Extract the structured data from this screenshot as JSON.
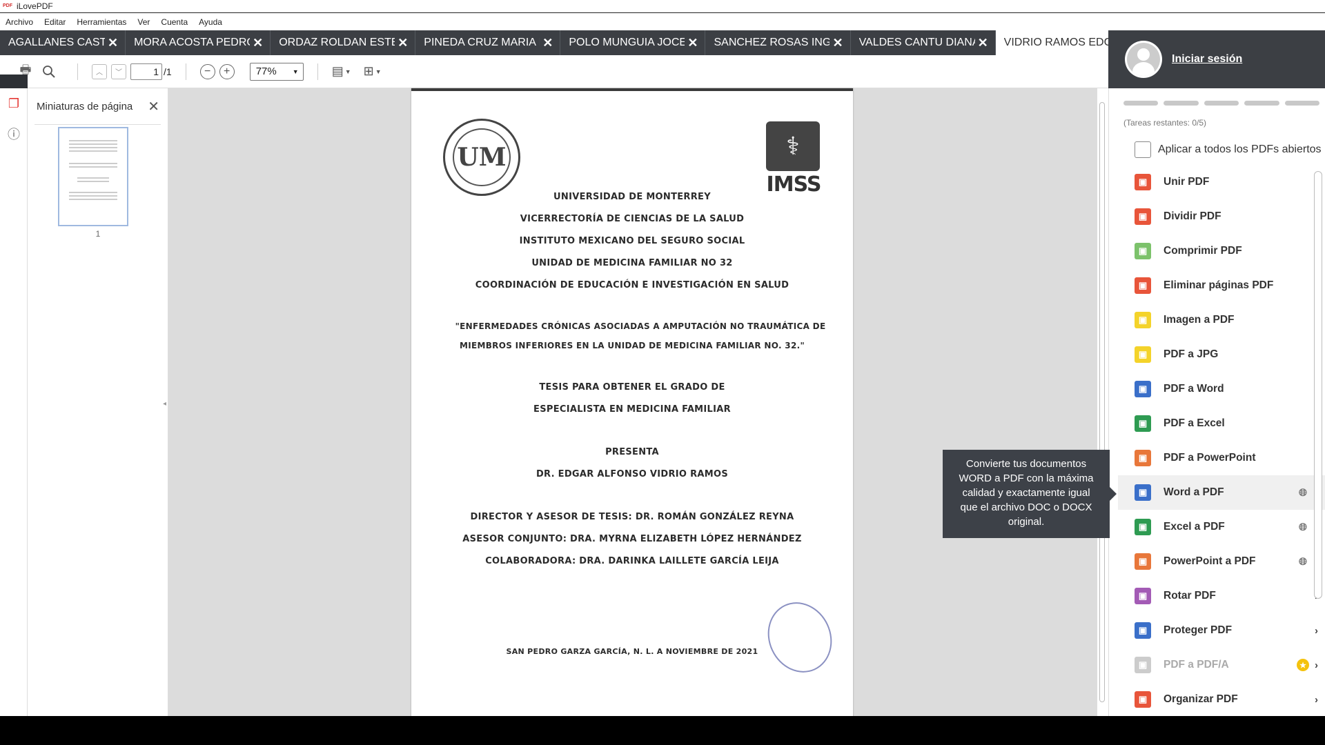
{
  "window": {
    "title": "iLovePDF",
    "app_icon": "pdf-icon"
  },
  "menu": [
    "Archivo",
    "Editar",
    "Herramientas",
    "Ver",
    "Cuenta",
    "Ayuda"
  ],
  "tabs": [
    {
      "label": "AGALLANES CASTRU"
    },
    {
      "label": "MORA ACOSTA PEDRO"
    },
    {
      "label": "ORDAZ ROLDAN ESTEF"
    },
    {
      "label": "PINEDA CRUZ MARIA I"
    },
    {
      "label": "POLO MUNGUIA JOCE"
    },
    {
      "label": "SANCHEZ ROSAS INGF"
    },
    {
      "label": "VALDES CANTU DIANA"
    },
    {
      "label": "VIDRIO RAMOS EDGAF",
      "active": true
    }
  ],
  "toolbar": {
    "page_current": "1",
    "page_total": "/1",
    "zoom": "77%"
  },
  "thumbnails": {
    "title": "Miniaturas de página",
    "page_number": "1"
  },
  "document": {
    "header_logo_right": "IMSS",
    "lines": [
      "UNIVERSIDAD DE MONTERREY",
      "VICERRECTORÍA DE CIENCIAS DE LA SALUD",
      "INSTITUTO MEXICANO DEL SEGURO SOCIAL",
      "UNIDAD DE MEDICINA FAMILIAR NO 32",
      "COORDINACIÓN DE EDUCACIÓN E INVESTIGACIÓN EN SALUD"
    ],
    "title_line1": "\"ENFERMEDADES CRÓNICAS ASOCIADAS A AMPUTACIÓN NO TRAUMÁTICA DE",
    "title_line2": "MIEMBROS INFERIORES EN LA UNIDAD DE MEDICINA FAMILIAR NO. 32.\"",
    "thesis_line1": "TESIS PARA OBTENER EL GRADO DE",
    "thesis_line2": "ESPECIALISTA EN MEDICINA FAMILIAR",
    "presenta": "PRESENTA",
    "author": "DR. EDGAR ALFONSO VIDRIO RAMOS",
    "director": "DIRECTOR Y ASESOR DE TESIS:  DR. ROMÁN GONZÁLEZ REYNA",
    "asesor": "ASESOR CONJUNTO: DRA. MYRNA ELIZABETH LÓPEZ HERNÁNDEZ",
    "colaboradora": "COLABORADORA: DRA. DARINKA LAILLETE GARCÍA LEIJA",
    "place_date": "SAN PEDRO GARZA GARCÍA, N. L. A NOVIEMBRE DE 2021"
  },
  "right_panel": {
    "login": "Iniciar sesión",
    "tasks_left": "(Tareas restantes: 0/5)",
    "apply_all": "Aplicar a todos los PDFs abiertos",
    "tools": [
      {
        "label": "Unir PDF",
        "color": "#e8553a",
        "icon": "merge-icon"
      },
      {
        "label": "Dividir PDF",
        "color": "#e8553a",
        "icon": "split-icon"
      },
      {
        "label": "Comprimir PDF",
        "color": "#7cc26b",
        "icon": "compress-icon"
      },
      {
        "label": "Eliminar páginas PDF",
        "color": "#e8553a",
        "icon": "delete-pages-icon"
      },
      {
        "label": "Imagen a PDF",
        "color": "#f4d32a",
        "icon": "image-icon"
      },
      {
        "label": "PDF a JPG",
        "color": "#f4d32a",
        "icon": "jpg-icon"
      },
      {
        "label": "PDF a Word",
        "color": "#3a6fc9",
        "icon": "word-icon"
      },
      {
        "label": "PDF a Excel",
        "color": "#2e9b52",
        "icon": "excel-icon"
      },
      {
        "label": "PDF a PowerPoint",
        "color": "#e8773a",
        "icon": "powerpoint-icon"
      },
      {
        "label": "Word a PDF",
        "color": "#3a6fc9",
        "icon": "word-to-pdf-icon",
        "globe": true,
        "hover": true
      },
      {
        "label": "Excel a PDF",
        "color": "#2e9b52",
        "icon": "excel-to-pdf-icon",
        "globe": true
      },
      {
        "label": "PowerPoint a PDF",
        "color": "#e8773a",
        "icon": "powerpoint-to-pdf-icon",
        "globe": true
      },
      {
        "label": "Rotar PDF",
        "color": "#a35bb5",
        "icon": "rotate-icon"
      },
      {
        "label": "Proteger PDF",
        "color": "#3a6fc9",
        "icon": "protect-icon"
      },
      {
        "label": "PDF a PDF/A",
        "color": "#cccccc",
        "icon": "pdfa-icon",
        "premium": true,
        "disabled": true
      },
      {
        "label": "Organizar PDF",
        "color": "#e8553a",
        "icon": "organize-icon"
      }
    ]
  },
  "tooltip": {
    "text": "Convierte tus documentos WORD a PDF con la máxima calidad y exactamente igual que el archivo DOC o DOCX original."
  }
}
